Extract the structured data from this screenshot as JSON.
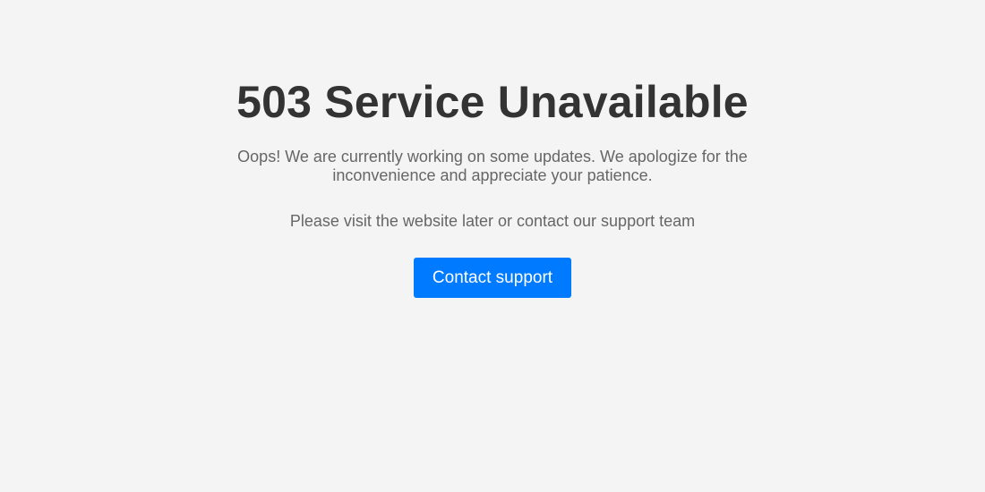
{
  "error": {
    "title": "503 Service Unavailable",
    "message": "Oops! We are currently working on some updates. We apologize for the inconvenience and appreciate your patience.",
    "hint": "Please visit the website later or contact our support team"
  },
  "actions": {
    "contact_label": "Contact support"
  },
  "colors": {
    "background": "#f4f4f4",
    "title": "#333333",
    "body_text": "#666666",
    "button": "#007bff",
    "button_text": "#ffffff"
  }
}
